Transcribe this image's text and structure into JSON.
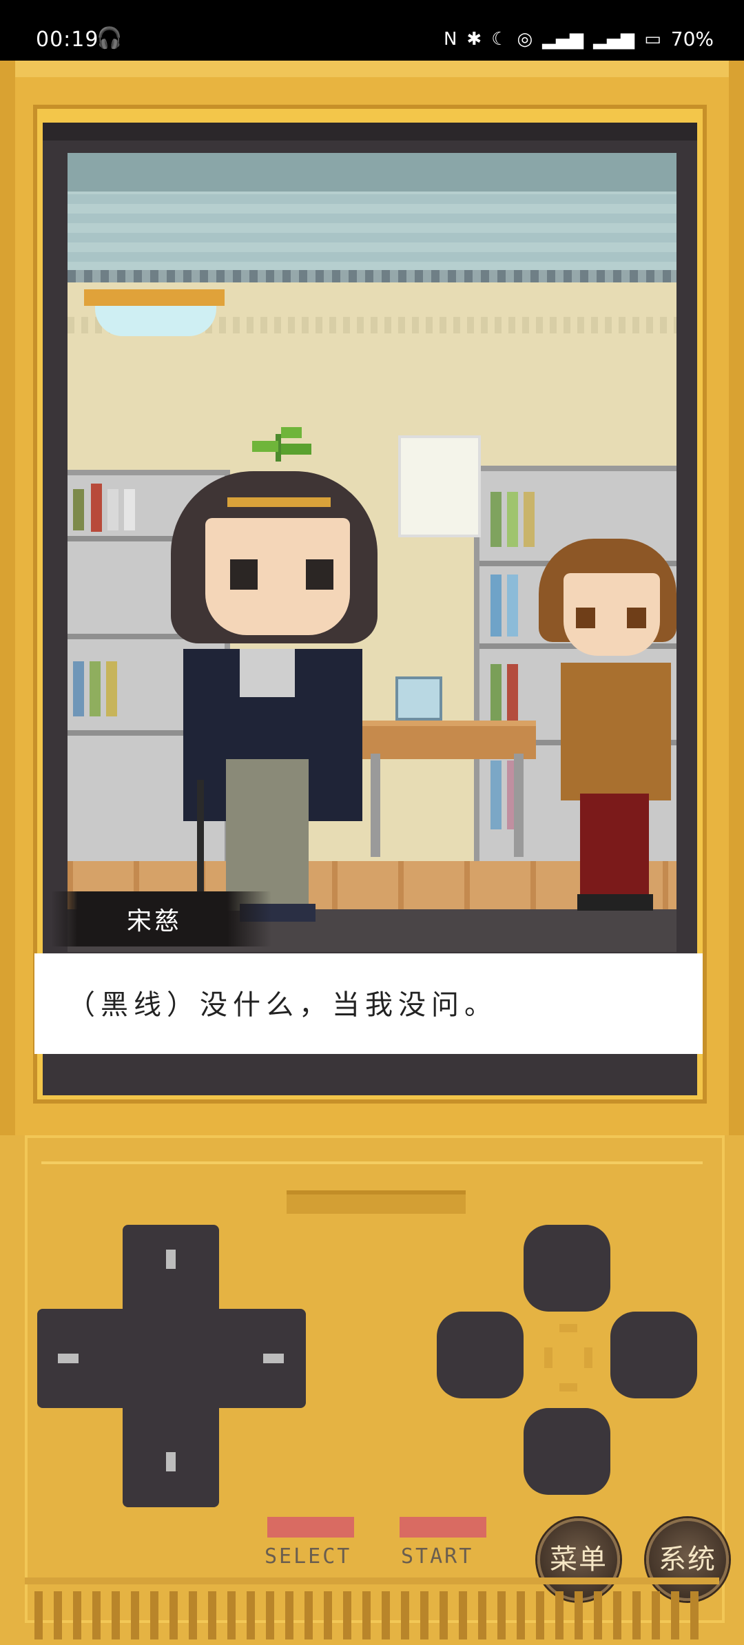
{
  "status_bar": {
    "time": "00:19",
    "battery": "70%",
    "icons": [
      "headphones-icon",
      "nfc-icon",
      "bluetooth-icon",
      "moon-icon",
      "hotspot-icon",
      "signal-5g-icon",
      "signal-4g-icon",
      "battery-icon"
    ]
  },
  "dialogue": {
    "speaker": "宋慈",
    "text": "（黑线）没什么，当我没问。"
  },
  "controls": {
    "select_label": "SELECT",
    "start_label": "START",
    "menu_label": "菜单",
    "system_label": "系统"
  },
  "colors": {
    "console": "#e5b343",
    "button_dark": "#3b363b",
    "select_start": "#d96b62"
  }
}
